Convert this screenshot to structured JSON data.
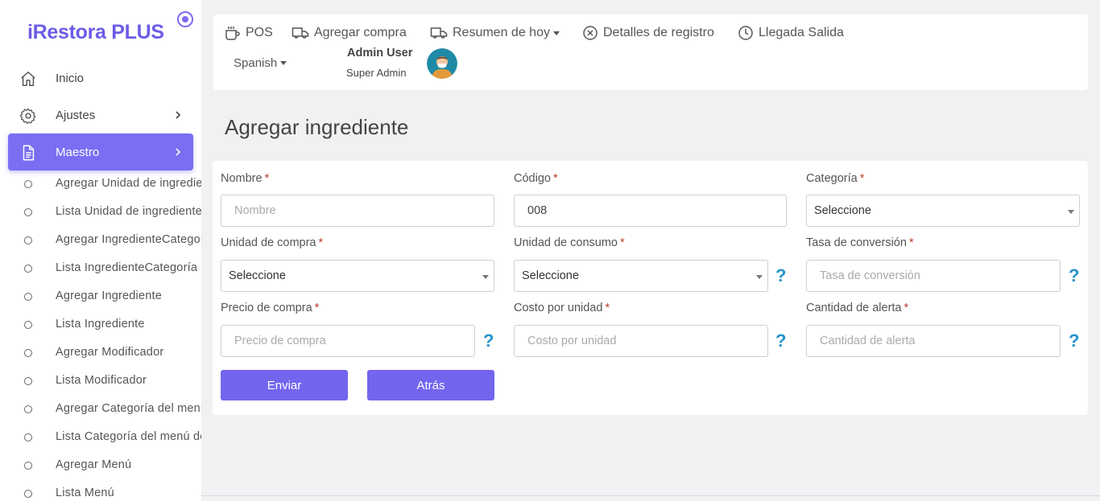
{
  "app": {
    "logo": "iRestora PLUS"
  },
  "sidebar": {
    "items": [
      {
        "label": "Inicio",
        "icon": "home-icon"
      },
      {
        "label": "Ajustes",
        "icon": "gear-icon"
      },
      {
        "label": "Maestro",
        "icon": "document-icon"
      }
    ],
    "sub_items": [
      "Agregar Unidad de ingredientes",
      "Lista Unidad de ingredientes",
      "Agregar IngredienteCategoría",
      "Lista IngredienteCategoría",
      "Agregar Ingrediente",
      "Lista Ingrediente",
      "Agregar Modificador",
      "Lista Modificador",
      "Agregar Categoría del menú",
      "Lista Categoría del menú de",
      "Agregar Menú",
      "Lista Menú"
    ]
  },
  "topbar": {
    "links": [
      "POS",
      "Agregar compra",
      "Resumen de hoy",
      "Detalles de registro",
      "Llegada Salida"
    ],
    "language": "Spanish",
    "user_name": "Admin User",
    "user_role": "Super Admin"
  },
  "page": {
    "title": "Agregar ingrediente"
  },
  "form": {
    "name": {
      "label": "Nombre",
      "placeholder": "Nombre"
    },
    "code": {
      "label": "Código",
      "value": "008"
    },
    "category": {
      "label": "Categoría",
      "value": "Seleccione"
    },
    "purchase_unit": {
      "label": "Unidad de compra",
      "value": "Seleccione"
    },
    "consumption_unit": {
      "label": "Unidad de consumo",
      "value": "Seleccione"
    },
    "conversion_rate": {
      "label": "Tasa de conversión",
      "placeholder": "Tasa de conversión"
    },
    "purchase_price": {
      "label": "Precio de compra",
      "placeholder": "Precio de compra"
    },
    "unit_cost": {
      "label": "Costo por unidad",
      "placeholder": "Costo por unidad"
    },
    "alert_qty": {
      "label": "Cantidad de alerta",
      "placeholder": "Cantidad de alerta"
    },
    "required_mark": "*",
    "help_mark": "?",
    "submit_label": "Enviar",
    "back_label": "Atrás"
  },
  "colors": {
    "accent": "#7365ee",
    "help": "#2493c9",
    "required": "#c0392b"
  }
}
